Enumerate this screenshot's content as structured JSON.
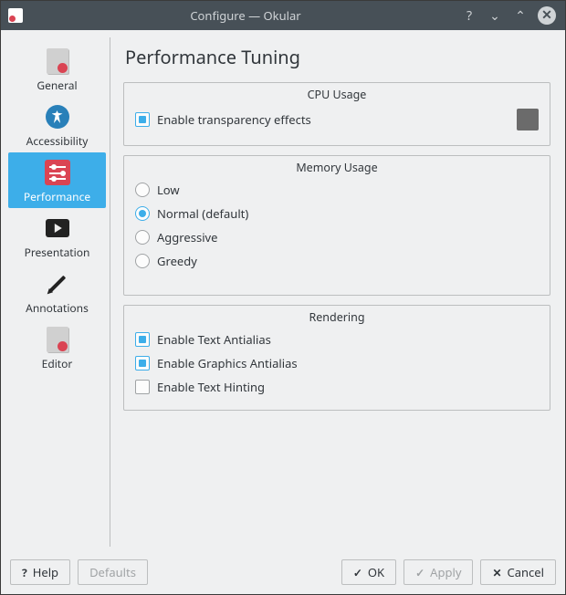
{
  "window": {
    "title": "Configure — Okular"
  },
  "sidebar": {
    "items": [
      {
        "label": "General"
      },
      {
        "label": "Accessibility"
      },
      {
        "label": "Performance"
      },
      {
        "label": "Presentation"
      },
      {
        "label": "Annotations"
      },
      {
        "label": "Editor"
      }
    ],
    "selected_index": 2
  },
  "page": {
    "title": "Performance Tuning",
    "cpu": {
      "group_title": "CPU Usage",
      "transparency": {
        "label": "Enable transparency effects",
        "checked": true
      }
    },
    "memory": {
      "group_title": "Memory Usage",
      "selected": "normal",
      "options": {
        "low": "Low",
        "normal": "Normal (default)",
        "aggressive": "Aggressive",
        "greedy": "Greedy"
      }
    },
    "rendering": {
      "group_title": "Rendering",
      "text_aa": {
        "label": "Enable Text Antialias",
        "checked": true
      },
      "gfx_aa": {
        "label": "Enable Graphics Antialias",
        "checked": true
      },
      "hinting": {
        "label": "Enable Text Hinting",
        "checked": false
      }
    }
  },
  "buttons": {
    "help": "Help",
    "defaults": "Defaults",
    "ok": "OK",
    "apply": "Apply",
    "cancel": "Cancel"
  }
}
